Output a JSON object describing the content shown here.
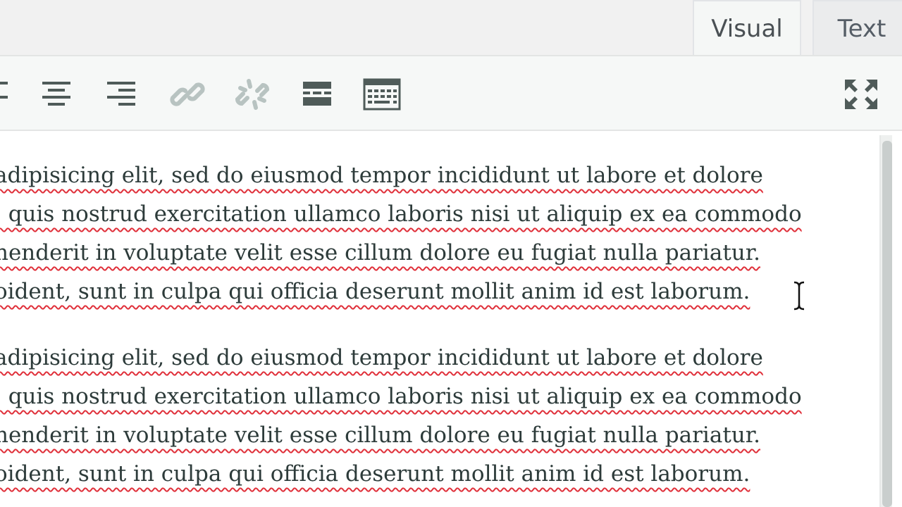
{
  "tabs": [
    {
      "label": "Visual",
      "active": true
    },
    {
      "label": "Text",
      "active": false
    }
  ],
  "toolbar": {
    "buttons": [
      {
        "name": "align-left-icon"
      },
      {
        "name": "align-center-icon"
      },
      {
        "name": "align-right-icon"
      },
      {
        "name": "link-icon"
      },
      {
        "name": "unlink-icon"
      },
      {
        "name": "read-more-icon"
      },
      {
        "name": "toolbar-toggle-icon"
      },
      {
        "name": "fullscreen-icon"
      }
    ]
  },
  "editor": {
    "paragraphs": [
      {
        "lines": [
          "adipisicing elit, sed do eiusmod tempor incididunt ut labore et dolore",
          ", quis nostrud exercitation ullamco laboris nisi ut aliquip ex ea commodo",
          "henderit in voluptate velit esse cillum dolore eu fugiat nulla pariatur.",
          "oident, sunt in culpa qui officia deserunt mollit anim id est laborum."
        ]
      },
      {
        "lines": [
          "adipisicing elit, sed do eiusmod tempor incididunt ut labore et dolore",
          ", quis nostrud exercitation ullamco laboris nisi ut aliquip ex ea commodo",
          "henderit in voluptate velit esse cillum dolore eu fugiat nulla pariatur.",
          "oident, sunt in culpa qui officia deserunt mollit anim id est laborum."
        ]
      }
    ]
  },
  "colors": {
    "text": "#2d3b3a",
    "spellcheck_underline": "#e0303a",
    "toolbar_bg": "#f6f8f7",
    "icon": "#4f5b59",
    "icon_disabled": "#b8c3c1"
  }
}
